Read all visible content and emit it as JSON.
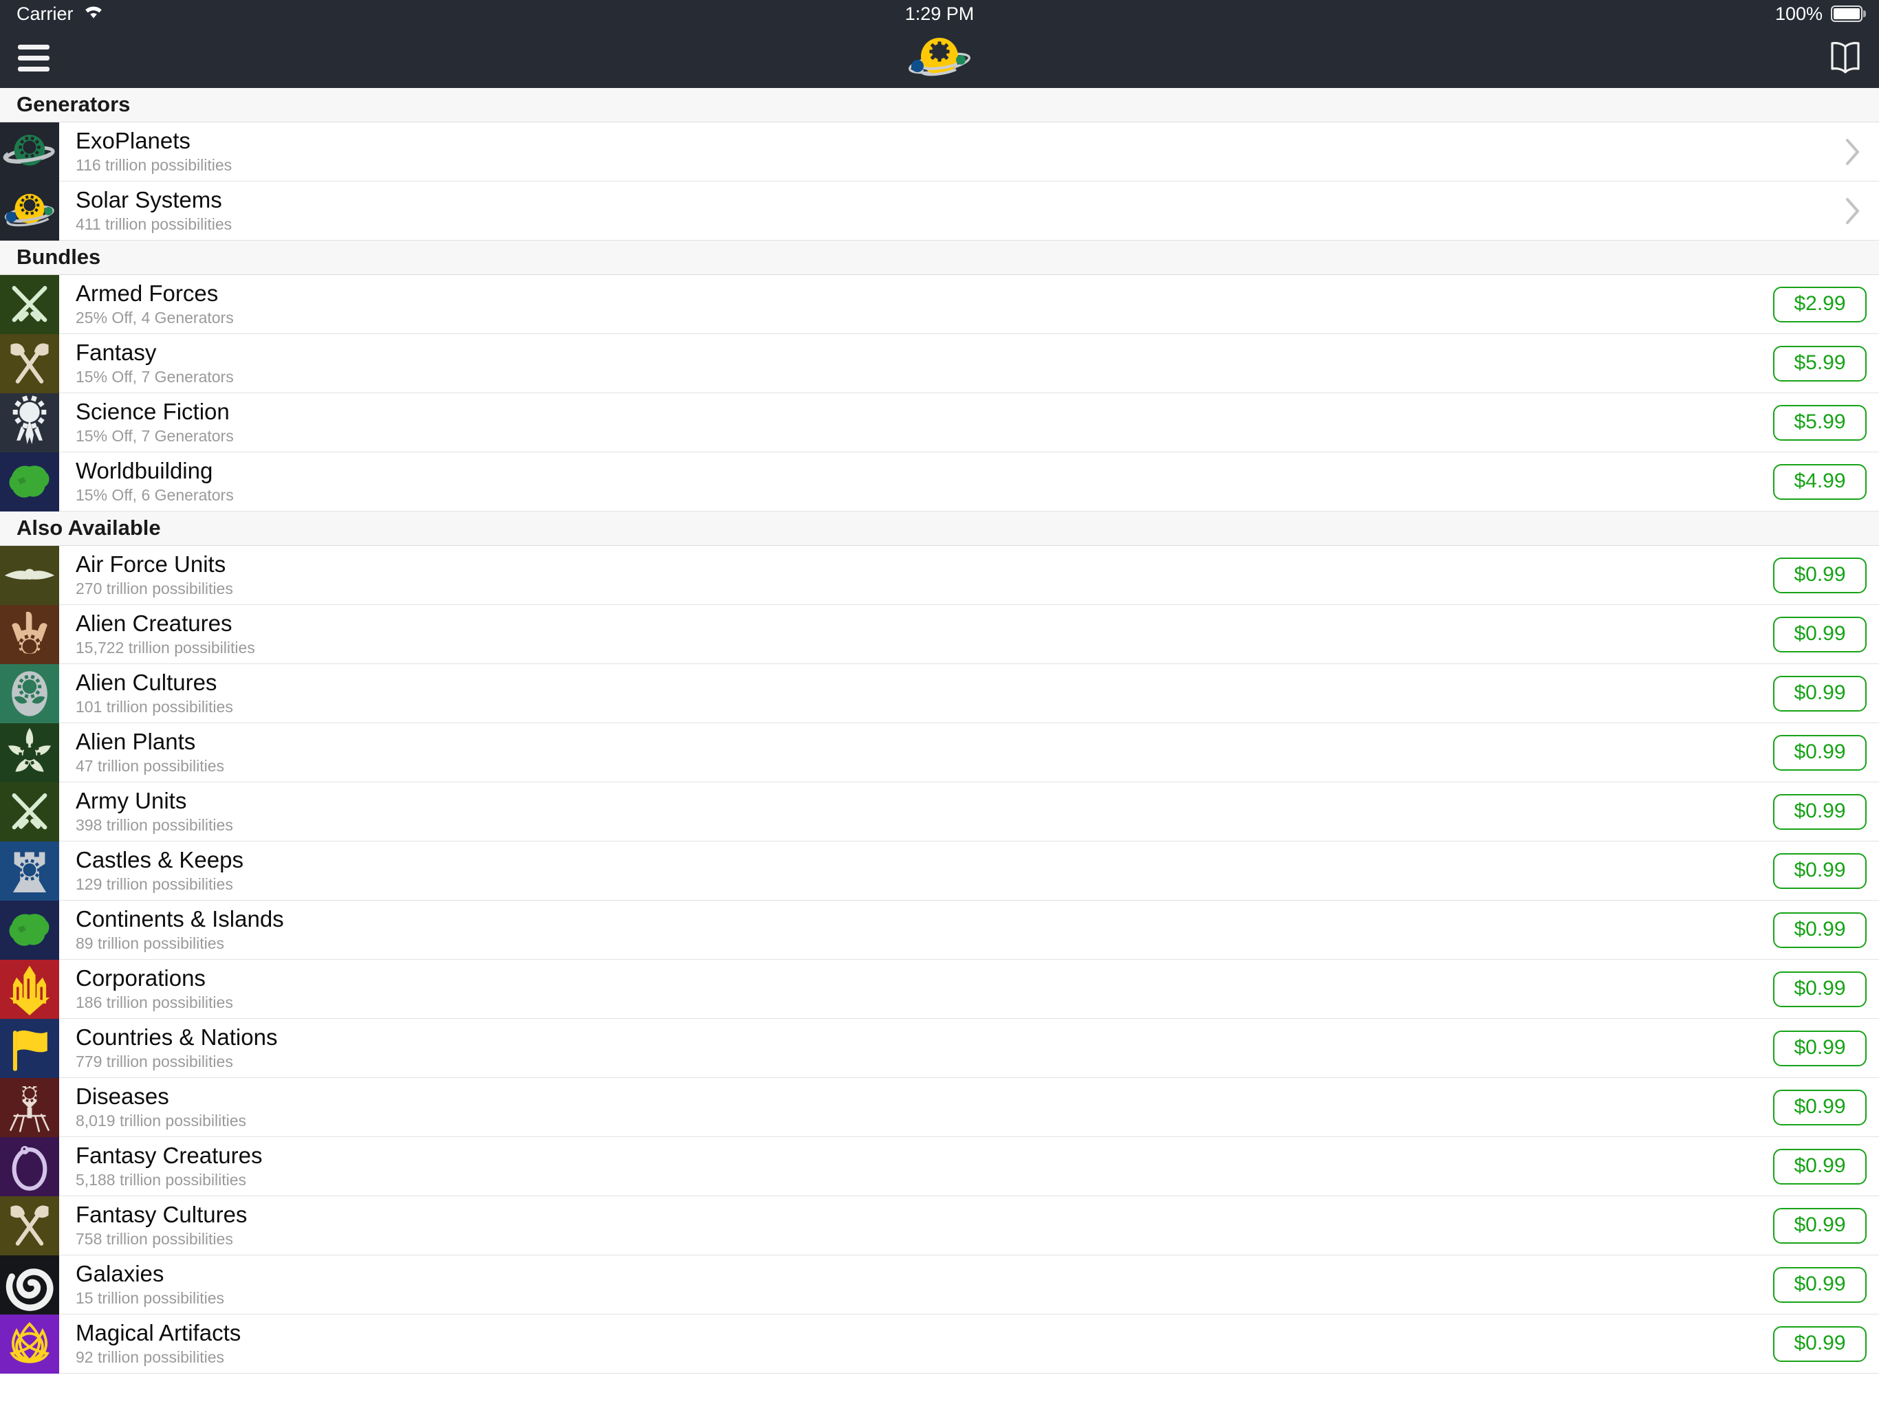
{
  "status_bar": {
    "carrier": "Carrier",
    "wifi_icon": "wifi-icon",
    "time": "1:29 PM",
    "battery_percent": "100%",
    "battery_icon": "battery-full-icon"
  },
  "navbar": {
    "menu_icon": "hamburger-menu-icon",
    "logo_icon": "planet-gear-logo-icon",
    "bookmark_icon": "open-book-icon",
    "background_color": "#272c34"
  },
  "theme": {
    "accent_green": "#17a317",
    "section_header_bg": "#f7f7f7",
    "subtitle_color": "#9a9a9a",
    "chevron_color": "#c3c3c3"
  },
  "sections": [
    {
      "header": "Generators",
      "rows": [
        {
          "title": "ExoPlanets",
          "subtitle": "116 trillion possibilities",
          "icon": "exoplanet-icon",
          "icon_bg": "#22262e",
          "accessory": "chevron",
          "price": null
        },
        {
          "title": "Solar Systems",
          "subtitle": "411 trillion possibilities",
          "icon": "solar-system-icon",
          "icon_bg": "#22262e",
          "accessory": "chevron",
          "price": null
        }
      ]
    },
    {
      "header": "Bundles",
      "rows": [
        {
          "title": "Armed Forces",
          "subtitle": "25% Off, 4 Generators",
          "icon": "crossed-rifles-icon",
          "icon_bg": "#2b4417",
          "accessory": "price",
          "price": "$2.99"
        },
        {
          "title": "Fantasy",
          "subtitle": "15% Off, 7 Generators",
          "icon": "crossed-axes-icon",
          "icon_bg": "#4e4716",
          "accessory": "price",
          "price": "$5.99"
        },
        {
          "title": "Science Fiction",
          "subtitle": "15% Off, 7 Generators",
          "icon": "starship-icon",
          "icon_bg": "#2b313c",
          "accessory": "price",
          "price": "$5.99"
        },
        {
          "title": "Worldbuilding",
          "subtitle": "15% Off, 6 Generators",
          "icon": "continent-icon",
          "icon_bg": "#1b2550",
          "accessory": "price",
          "price": "$4.99"
        }
      ]
    },
    {
      "header": "Also Available",
      "rows": [
        {
          "title": "Air Force Units",
          "subtitle": "270 trillion possibilities",
          "icon": "winged-aircraft-icon",
          "icon_bg": "#45461a",
          "accessory": "price",
          "price": "$0.99"
        },
        {
          "title": "Alien Creatures",
          "subtitle": "15,722 trillion possibilities",
          "icon": "alien-claw-icon",
          "icon_bg": "#5b3219",
          "accessory": "price",
          "price": "$0.99"
        },
        {
          "title": "Alien Cultures",
          "subtitle": "101 trillion possibilities",
          "icon": "alien-head-icon",
          "icon_bg": "#2d7a5a",
          "accessory": "price",
          "price": "$0.99"
        },
        {
          "title": "Alien Plants",
          "subtitle": "47 trillion possibilities",
          "icon": "alien-flower-icon",
          "icon_bg": "#1f401c",
          "accessory": "price",
          "price": "$0.99"
        },
        {
          "title": "Army Units",
          "subtitle": "398 trillion possibilities",
          "icon": "crossed-rifles-icon",
          "icon_bg": "#2b4417",
          "accessory": "price",
          "price": "$0.99"
        },
        {
          "title": "Castles & Keeps",
          "subtitle": "129 trillion possibilities",
          "icon": "castle-tower-icon",
          "icon_bg": "#1b4a80",
          "accessory": "price",
          "price": "$0.99"
        },
        {
          "title": "Continents & Islands",
          "subtitle": "89 trillion possibilities",
          "icon": "continent-icon",
          "icon_bg": "#1b2550",
          "accessory": "price",
          "price": "$0.99"
        },
        {
          "title": "Corporations",
          "subtitle": "186 trillion possibilities",
          "icon": "skyscraper-icon",
          "icon_bg": "#b01f28",
          "accessory": "price",
          "price": "$0.99"
        },
        {
          "title": "Countries & Nations",
          "subtitle": "779 trillion possibilities",
          "icon": "flag-icon",
          "icon_bg": "#1b2f63",
          "accessory": "price",
          "price": "$0.99"
        },
        {
          "title": "Diseases",
          "subtitle": "8,019 trillion possibilities",
          "icon": "bacteriophage-icon",
          "icon_bg": "#5a1d1d",
          "accessory": "price",
          "price": "$0.99"
        },
        {
          "title": "Fantasy Creatures",
          "subtitle": "5,188 trillion possibilities",
          "icon": "ouroboros-icon",
          "icon_bg": "#3a1650",
          "accessory": "price",
          "price": "$0.99"
        },
        {
          "title": "Fantasy Cultures",
          "subtitle": "758 trillion possibilities",
          "icon": "crossed-axes-icon",
          "icon_bg": "#4e4716",
          "accessory": "price",
          "price": "$0.99"
        },
        {
          "title": "Galaxies",
          "subtitle": "15 trillion possibilities",
          "icon": "spiral-galaxy-icon",
          "icon_bg": "#15161a",
          "accessory": "price",
          "price": "$0.99"
        },
        {
          "title": "Magical Artifacts",
          "subtitle": "92 trillion possibilities",
          "icon": "triquetra-knot-icon",
          "icon_bg": "#7722c0",
          "accessory": "price",
          "price": "$0.99"
        }
      ]
    }
  ]
}
